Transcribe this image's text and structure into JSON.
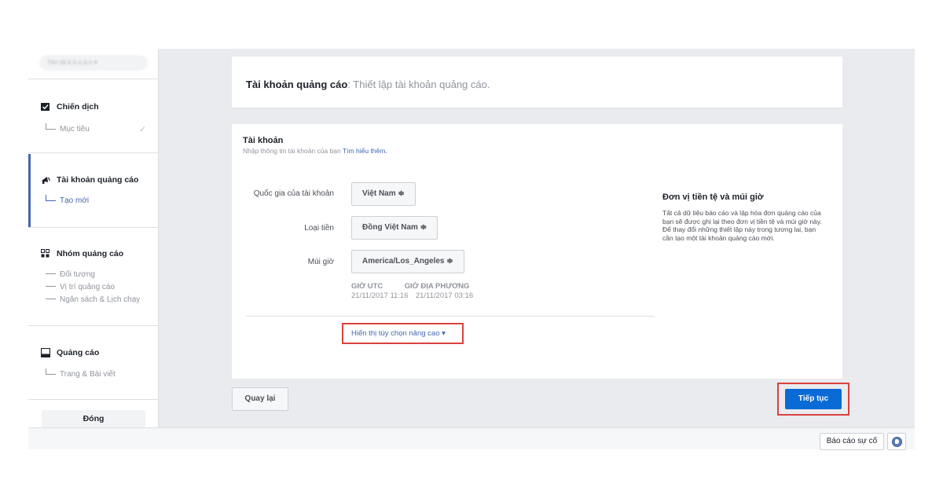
{
  "sidebar": {
    "account_selector": "Tên tài k.h.o.ả.n ▾",
    "sections": [
      {
        "title": "Chiến dịch",
        "icon": "checkbox-icon",
        "subitems": [
          {
            "label": "Mục tiêu",
            "done": true
          }
        ]
      },
      {
        "title": "Tài khoản quảng cáo",
        "icon": "megaphone-icon",
        "active": true,
        "subitems": [
          {
            "label": "Tạo mới",
            "active": true
          }
        ]
      },
      {
        "title": "Nhóm quảng cáo",
        "icon": "grid-icon",
        "subitems": [
          {
            "label": "Đối tượng"
          },
          {
            "label": "Vị trí quảng cáo"
          },
          {
            "label": "Ngân sách & Lịch chạy"
          }
        ]
      },
      {
        "title": "Quảng cáo",
        "icon": "window-icon",
        "subitems": [
          {
            "label": "Trang & Bài viết"
          }
        ]
      }
    ],
    "close_label": "Đóng"
  },
  "header": {
    "title_bold": "Tài khoản quảng cáo",
    "title_rest": ": Thiết lập tài khoản quảng cáo."
  },
  "form": {
    "section_title": "Tài khoản",
    "section_desc": "Nhập thông tin tài khoản của bạn",
    "learn_more": "Tìm hiểu thêm.",
    "fields": {
      "country_label": "Quốc gia của tài khoản",
      "country_value": "Việt Nam ≑",
      "currency_label": "Loại tiền",
      "currency_value": "Đồng Việt Nam ≑",
      "timezone_label": "Múi giờ",
      "timezone_value": "America/Los_Angeles ≑"
    },
    "time": {
      "utc_header": "GIỜ UTC",
      "utc_value": "21/11/2017 11:16",
      "local_header": "GIỜ ĐỊA PHƯƠNG",
      "local_value": "21/11/2017 03:16"
    },
    "advanced_link": "Hiển thị tùy chọn nâng cao ▾",
    "side_title": "Đơn vị tiền tệ và múi giờ",
    "side_text": "Tất cả dữ liệu báo cáo và lập hóa đơn quảng cáo của bạn sẽ được ghi lại theo đơn vị tiền tệ và múi giờ này. Để thay đổi những thiết lập này trong tương lai, bạn cần tạo một tài khoản quảng cáo mới."
  },
  "footer": {
    "back_label": "Quay lại",
    "next_label": "Tiếp tục"
  },
  "bottom": {
    "report_label": "Báo cáo sự cố"
  },
  "colors": {
    "accent": "#4267b2",
    "primary_button": "#0a6bd6",
    "highlight_border": "#d9433e",
    "background": "#e9ebee"
  }
}
